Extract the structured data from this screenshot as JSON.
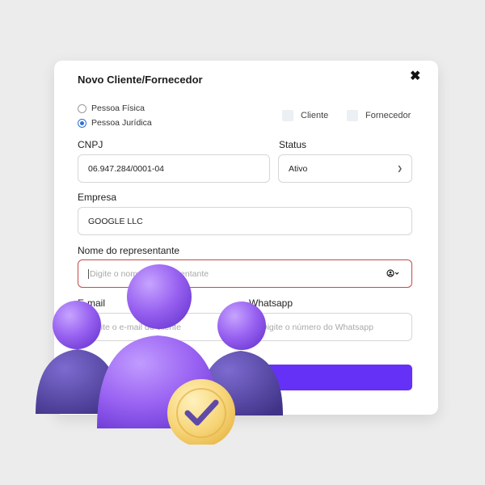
{
  "modal": {
    "title": "Novo Cliente/Fornecedor",
    "close_label": "✖"
  },
  "person_type": {
    "options": [
      "Pessoa Física",
      "Pessoa Jurídica"
    ],
    "selected": "Pessoa Jurídica"
  },
  "roles": {
    "cliente_label": "Cliente",
    "fornecedor_label": "Fornecedor"
  },
  "cnpj": {
    "label": "CNPJ",
    "value": "06.947.284/0001-04"
  },
  "status": {
    "label": "Status",
    "value": "Ativo"
  },
  "empresa": {
    "label": "Empresa",
    "value": "GOOGLE LLC"
  },
  "representante": {
    "label": "Nome do representante",
    "placeholder": "Digite o nome do representante"
  },
  "email": {
    "label": "E-mail",
    "placeholder": "Digite o e-mail do cliente"
  },
  "whatsapp": {
    "label": "Whatsapp",
    "placeholder": "Digite o número do Whatsapp"
  },
  "colors": {
    "accent": "#6531f6",
    "error_border": "#c24b4b",
    "radio_selected": "#2f6fd6",
    "person_front": "#9a63f2",
    "person_back": "#4f4298",
    "badge": "#f7d679"
  },
  "icons": {
    "close": "close-icon",
    "user_dropdown": "user-circle-icon",
    "status_dropdown": "chevron-down-icon",
    "badge": "check-icon"
  }
}
